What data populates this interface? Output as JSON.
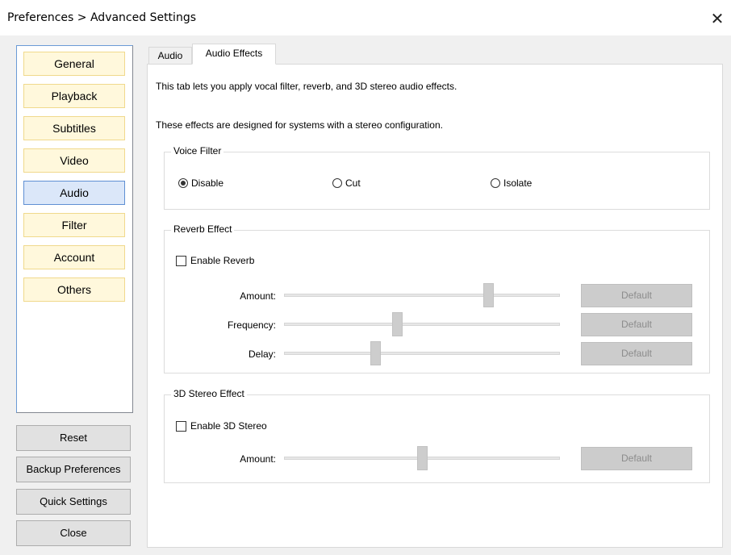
{
  "window": {
    "title": "Preferences > Advanced Settings",
    "close_glyph": "✕"
  },
  "sidebar": {
    "items": [
      {
        "label": "General",
        "active": false
      },
      {
        "label": "Playback",
        "active": false
      },
      {
        "label": "Subtitles",
        "active": false
      },
      {
        "label": "Video",
        "active": false
      },
      {
        "label": "Audio",
        "active": true
      },
      {
        "label": "Filter",
        "active": false
      },
      {
        "label": "Account",
        "active": false
      },
      {
        "label": "Others",
        "active": false
      }
    ]
  },
  "buttons": {
    "reset": "Reset",
    "backup": "Backup Preferences",
    "quick": "Quick Settings",
    "close": "Close"
  },
  "tabs": [
    {
      "label": "Audio",
      "active": false
    },
    {
      "label": "Audio Effects",
      "active": true
    }
  ],
  "content": {
    "intro": "This tab lets you apply vocal filter, reverb, and 3D stereo audio effects.",
    "note": "These effects are designed for systems with a stereo configuration.",
    "voice_filter": {
      "title": "Voice Filter",
      "options": [
        "Disable",
        "Cut",
        "Isolate"
      ],
      "selected": "Disable"
    },
    "reverb": {
      "title": "Reverb Effect",
      "enable_label": "Enable Reverb",
      "enabled": false,
      "sliders": [
        {
          "label": "Amount:",
          "value": 0.74,
          "button": "Default"
        },
        {
          "label": "Frequency:",
          "value": 0.41,
          "button": "Default"
        },
        {
          "label": "Delay:",
          "value": 0.33,
          "button": "Default"
        }
      ]
    },
    "stereo": {
      "title": "3D Stereo Effect",
      "enable_label": "Enable 3D Stereo",
      "enabled": false,
      "sliders": [
        {
          "label": "Amount:",
          "value": 0.5,
          "button": "Default"
        }
      ]
    }
  }
}
